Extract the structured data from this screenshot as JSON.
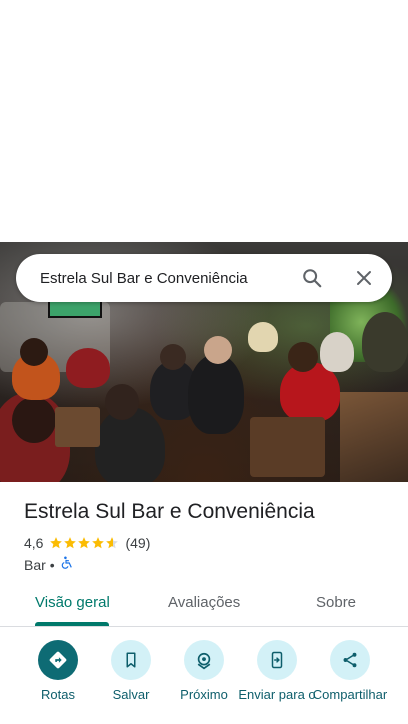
{
  "search": {
    "query": "Estrela Sul Bar e Conveniência"
  },
  "place": {
    "name": "Estrela Sul Bar e Conveniência",
    "rating": "4,6",
    "stars": 4.6,
    "review_count": "(49)",
    "category": "Bar",
    "separator": "•",
    "accessibility_icon": "wheelchair-icon"
  },
  "tabs": [
    {
      "label": "Visão geral",
      "active": true
    },
    {
      "label": "Avaliações",
      "active": false
    },
    {
      "label": "Sobre",
      "active": false
    }
  ],
  "actions": [
    {
      "label": "Rotas",
      "icon": "directions-icon"
    },
    {
      "label": "Salvar",
      "icon": "bookmark-icon"
    },
    {
      "label": "Próximo",
      "icon": "nearby-icon"
    },
    {
      "label": "Enviar para o",
      "icon": "send-to-phone-icon"
    },
    {
      "label": "Compartilhar",
      "icon": "share-icon"
    }
  ],
  "colors": {
    "accent": "#00796b",
    "action_primary": "#0e6b74",
    "action_bg": "#d3f1f7",
    "star": "#fbbc04"
  }
}
